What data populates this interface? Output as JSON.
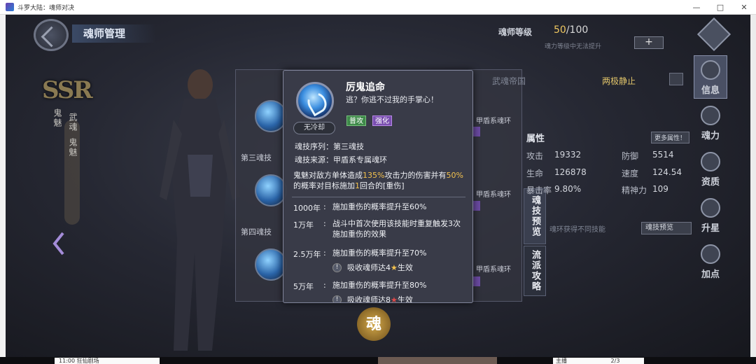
{
  "window": {
    "title": "斗罗大陆：魂师对决",
    "controls": [
      "—",
      "□",
      "✕"
    ]
  },
  "header": {
    "title": "魂师管理"
  },
  "character": {
    "rarity": "SSR",
    "name_vertical": "鬼魅",
    "title_vertical": "武魂",
    "subtitle_vertical": "鬼魅"
  },
  "rank": {
    "label": "魂师等级",
    "current": "50",
    "max": "/100",
    "sub": "魂力等级中无法提升",
    "plus": "+"
  },
  "affiliation": {
    "faction": "武魂帝国",
    "status": "两极静止"
  },
  "attributes": {
    "heading": "属性",
    "more": "更多属性！",
    "rows": [
      {
        "label": "攻击",
        "value": "19332",
        "label2": "防御",
        "value2": "5514"
      },
      {
        "label": "生命",
        "value": "126878",
        "label2": "速度",
        "value2": "124.54"
      },
      {
        "label": "暴击率",
        "value": "9.80%",
        "label2": "精神力",
        "value2": "109"
      }
    ],
    "hint": "魂环获得不同技能",
    "preview_button": "魂技预览"
  },
  "back_panel": {
    "skill_labels": [
      "第三魂技",
      "第四魂技"
    ],
    "ring_labels": [
      "甲盾系魂环",
      "甲盾系魂环",
      "甲盾系魂环"
    ]
  },
  "side_tabs": [
    "魂技预览",
    "流派攻略"
  ],
  "right_nav": [
    {
      "label": "信息",
      "icon": "info-icon",
      "active": true
    },
    {
      "label": "魂力",
      "icon": "soul-power-icon",
      "active": false
    },
    {
      "label": "资质",
      "icon": "aptitude-icon",
      "active": false
    },
    {
      "label": "升星",
      "icon": "star-up-icon",
      "active": false
    },
    {
      "label": "加点",
      "icon": "add-point-icon",
      "active": false
    }
  ],
  "bottom_seal": "魂",
  "tooltip": {
    "name": "厉鬼追命",
    "quote": "逃？你逃不过我的手掌心！",
    "cooldown": "无冷却",
    "tags": [
      "普攻",
      "强化"
    ],
    "sequence_label": "魂技序列：",
    "sequence_value": "第三魂技",
    "source_label": "魂技来源：",
    "source_value": "甲盾系专属魂环",
    "desc_part1": "鬼魅对敌方单体造成",
    "desc_pct1": "135%",
    "desc_part2": "攻击力的伤害并有",
    "desc_pct2": "50%",
    "desc_part3": "的概率对目标施加",
    "desc_turns": "1",
    "desc_part4": "回合的[重伤]",
    "levels": [
      {
        "year": "1000年",
        "text": "施加重伤的概率提升至60%"
      },
      {
        "year": "1万年",
        "text": "战斗中首次使用该技能时重复触发3次施加重伤的效果"
      },
      {
        "year": "2.5万年",
        "text": "施加重伤的概率提升至70%",
        "req": "吸收魂师达4",
        "req_suffix": "生效"
      },
      {
        "year": "5万年",
        "text": "施加重伤的概率提升至80%",
        "req": "吸收魂师达8",
        "req_suffix": "生效"
      }
    ],
    "colors": {
      "highlight": "#f2c14e",
      "tag_green": "#3f8a4a",
      "tag_purple": "#7a4fb0"
    }
  },
  "bottom_bar": {
    "left_text": "11:00 狂仙剧场",
    "right_text": "主播",
    "page": "2/3"
  }
}
